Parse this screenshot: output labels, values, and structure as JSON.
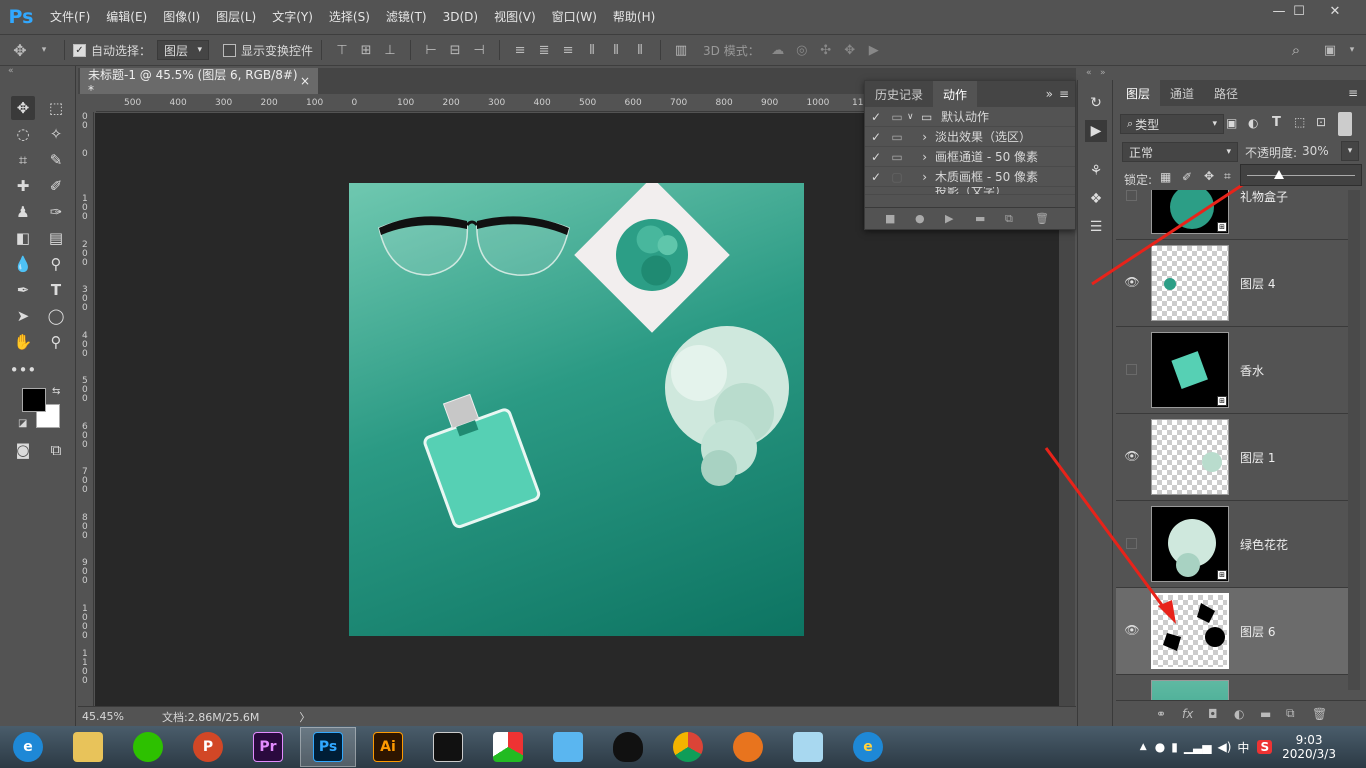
{
  "app": {
    "logo": "Ps",
    "accent": "#31a8ff"
  },
  "menu": [
    "文件(F)",
    "编辑(E)",
    "图像(I)",
    "图层(L)",
    "文字(Y)",
    "选择(S)",
    "滤镜(T)",
    "3D(D)",
    "视图(V)",
    "窗口(W)",
    "帮助(H)"
  ],
  "window": {
    "minimize": "—",
    "maximize": "☐",
    "close": "✕"
  },
  "options": {
    "auto_select_label": "自动选择：",
    "auto_select_value": "图层",
    "show_transform_label": "显示变换控件",
    "mode_3d_label": "3D 模式："
  },
  "doc": {
    "tab_title": "未标题-1 @ 45.5% (图层 6, RGB/8#) *",
    "close": "×"
  },
  "ruler": {
    "h": [
      "500",
      "400",
      "300",
      "200",
      "100",
      "0",
      "100",
      "200",
      "300",
      "400",
      "500",
      "600",
      "700",
      "800",
      "900",
      "1000",
      "1100",
      "1200",
      "1300",
      "1400"
    ],
    "v": [
      "1\n0\n0",
      "0",
      "1\n0\n0",
      "2\n0\n0",
      "3\n0\n0",
      "4\n0\n0",
      "5\n0\n0",
      "6\n0\n0",
      "7\n0\n0",
      "8\n0\n0",
      "9\n0\n0",
      "1\n0\n0\n0",
      "1\n1\n0\n0"
    ]
  },
  "status": {
    "zoom": "45.45%",
    "doc_info": "文档:2.86M/25.6M",
    "arrow": "〉"
  },
  "history_panel": {
    "tabs": [
      "历史记录",
      "动作"
    ],
    "actions": [
      {
        "label": "默认动作",
        "checked": true,
        "type": "folder"
      },
      {
        "label": "淡出效果（选区）",
        "checked": true,
        "type": "item"
      },
      {
        "label": "画框通道 - 50 像素",
        "checked": true,
        "type": "item"
      },
      {
        "label": "木质画框 - 50 像素",
        "checked": true,
        "type": "item"
      },
      {
        "label": "投影（文字）",
        "checked": true,
        "type": "item"
      }
    ]
  },
  "layers_panel": {
    "tabs": [
      "图层",
      "通道",
      "路径"
    ],
    "filter_label": "类型",
    "blend_mode": "正常",
    "opacity_label": "不透明度:",
    "opacity_value": "30%",
    "lock_label": "锁定:",
    "layers": [
      {
        "name": "礼物盒子",
        "visible": false,
        "thumb": "black"
      },
      {
        "name": "图层 4",
        "visible": true,
        "thumb": "trans"
      },
      {
        "name": "香水",
        "visible": false,
        "thumb": "black"
      },
      {
        "name": "图层 1",
        "visible": true,
        "thumb": "trans"
      },
      {
        "name": "绿色花花",
        "visible": false,
        "thumb": "black"
      },
      {
        "name": "图层 6",
        "visible": true,
        "thumb": "trans",
        "selected": true
      }
    ]
  },
  "taskbar": {
    "apps": [
      "IE",
      "Explorer",
      "WeChat",
      "PowerPoint",
      "Premiere",
      "Photoshop",
      "Illustrator",
      "Video",
      "App",
      "Teambition",
      "QQ",
      "Chrome",
      "Foxmail",
      "Notepad",
      "Edge"
    ],
    "ppt": "P",
    "pr": "Pr",
    "ps": "Ps",
    "ai": "Ai",
    "tray_ime": "中",
    "tray_s": "S",
    "time": "9:03",
    "date": "2020/3/3"
  }
}
